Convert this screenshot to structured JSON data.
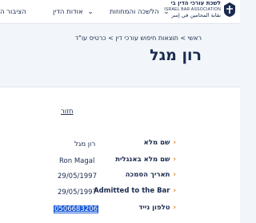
{
  "nav": {
    "items": [
      {
        "label": "הלשכה והמחוזות"
      },
      {
        "label": "אודות הדין"
      },
      {
        "label": "הציבור ה"
      }
    ],
    "logo": {
      "hebrew": "לשכת עורכי הדין בישראל",
      "english": "ISRAEL BAR ASSOCIATION",
      "arabic": "نقابة المحامين في إسرائيل"
    }
  },
  "breadcrumb": "ראשי > תוצאות חיפוש עורכי דין > כרטיס עו\"ד",
  "title": "רון מגל",
  "back_link": "חזור",
  "details": [
    {
      "label": "שם מלא",
      "value": "רון מגל"
    },
    {
      "label": "שם מלא באנגלית",
      "value": "Ron Magal"
    },
    {
      "label": "תאריך הסמכה",
      "value": "29/05/1997"
    },
    {
      "label": "Admitted to the Bar",
      "value": "29/05/1997"
    },
    {
      "label": "טלפון נייד",
      "value": "0506683206"
    }
  ],
  "colors": {
    "navy": "#1b2b4f",
    "accent_orange": "#e07b1a",
    "selection_blue": "#1a5bd6",
    "background": "#f2f5f9"
  }
}
